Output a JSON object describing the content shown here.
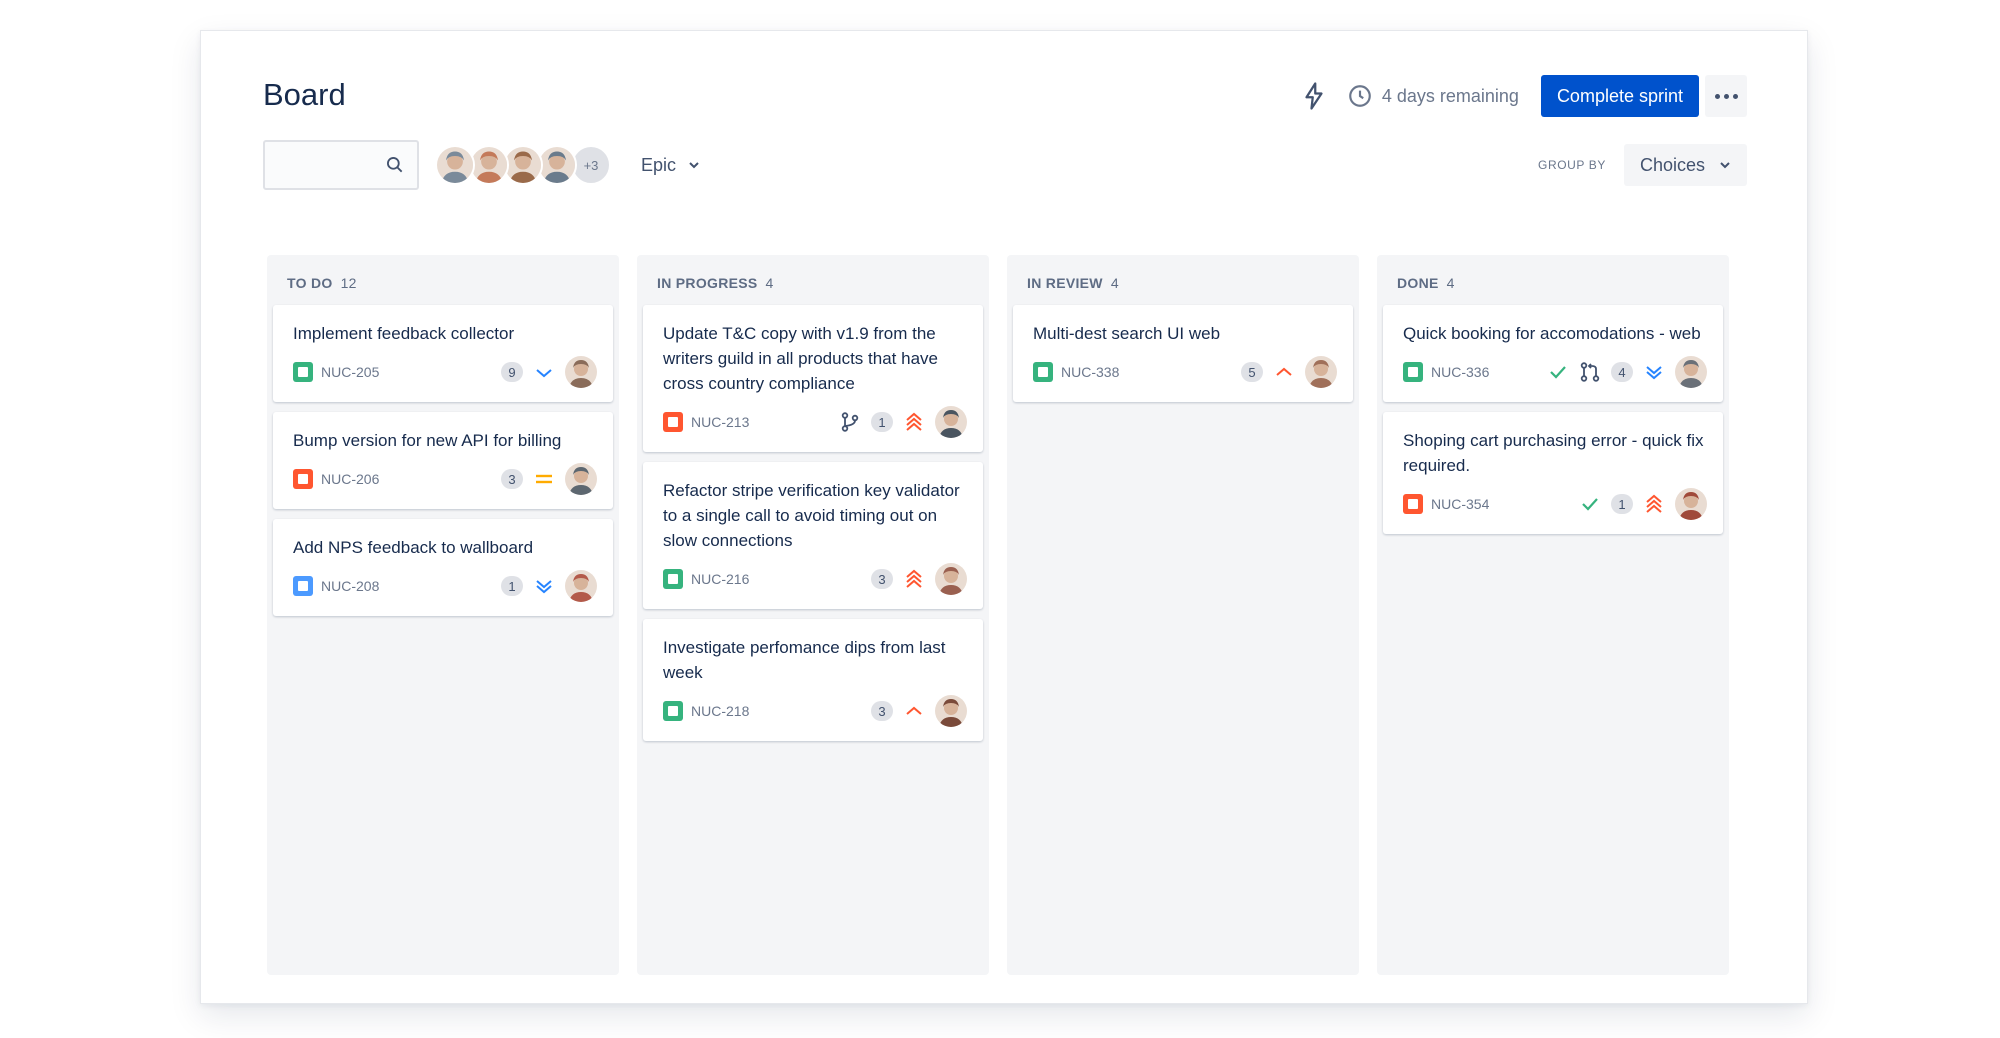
{
  "board": {
    "title": "Board"
  },
  "sprint": {
    "remaining": "4 days remaining",
    "complete_label": "Complete sprint"
  },
  "search": {
    "placeholder": ""
  },
  "avatars": {
    "more": "+3",
    "colors": [
      "#7a8a9a",
      "#c47a5a",
      "#9a6a4a",
      "#6a7b8c"
    ]
  },
  "filter": {
    "epic_label": "Epic"
  },
  "group_by": {
    "label": "GROUP BY",
    "value": "Choices"
  },
  "columns": [
    {
      "name": "TO DO",
      "count": "12",
      "cards": [
        {
          "title": "Implement feedback collector",
          "key": "NUC-205",
          "type": "story",
          "estimate": "9",
          "priority": "low",
          "avatar": "#8a6c5a"
        },
        {
          "title": "Bump version for new API for billing",
          "key": "NUC-206",
          "type": "bug",
          "estimate": "3",
          "priority": "medium",
          "avatar": "#5d6770"
        },
        {
          "title": "Add NPS feedback to wallboard",
          "key": "NUC-208",
          "type": "task",
          "estimate": "1",
          "priority": "lowest",
          "avatar": "#b35a4a"
        }
      ]
    },
    {
      "name": "IN PROGRESS",
      "count": "4",
      "cards": [
        {
          "title": "Update T&C copy with v1.9 from the writers guild in all products that have cross country compliance",
          "key": "NUC-213",
          "type": "bug",
          "estimate": "1",
          "priority": "highest",
          "branch": true,
          "avatar": "#4a5560"
        },
        {
          "title": "Refactor stripe verification key validator to a single call to avoid timing out on slow connections",
          "key": "NUC-216",
          "type": "story",
          "estimate": "3",
          "priority": "highest",
          "avatar": "#9a6050"
        },
        {
          "title": "Investigate perfomance dips from last week",
          "key": "NUC-218",
          "type": "story",
          "estimate": "3",
          "priority": "high",
          "avatar": "#7a4a3a"
        }
      ]
    },
    {
      "name": "IN REVIEW",
      "count": "4",
      "cards": [
        {
          "title": "Multi-dest search UI web",
          "key": "NUC-338",
          "type": "story",
          "estimate": "5",
          "priority": "high",
          "avatar": "#a0705a"
        }
      ]
    },
    {
      "name": "DONE",
      "count": "4",
      "cards": [
        {
          "title": "Quick booking for accomodations - web",
          "key": "NUC-336",
          "type": "story",
          "estimate": "4",
          "priority": "lowest",
          "done": true,
          "pr": true,
          "avatar": "#6a7078"
        },
        {
          "title": "Shoping cart purchasing error - quick fix required.",
          "key": "NUC-354",
          "type": "bug",
          "estimate": "1",
          "priority": "highest",
          "done": true,
          "avatar": "#a04a3a"
        }
      ]
    }
  ],
  "colors": {
    "primary": "#0052cc",
    "story": "#36b37e",
    "bug": "#ff5630",
    "task": "#4c9aff",
    "priority_high": "#ff5630",
    "priority_low": "#2684ff",
    "priority_medium": "#ffab00",
    "done_check": "#36b37e"
  }
}
